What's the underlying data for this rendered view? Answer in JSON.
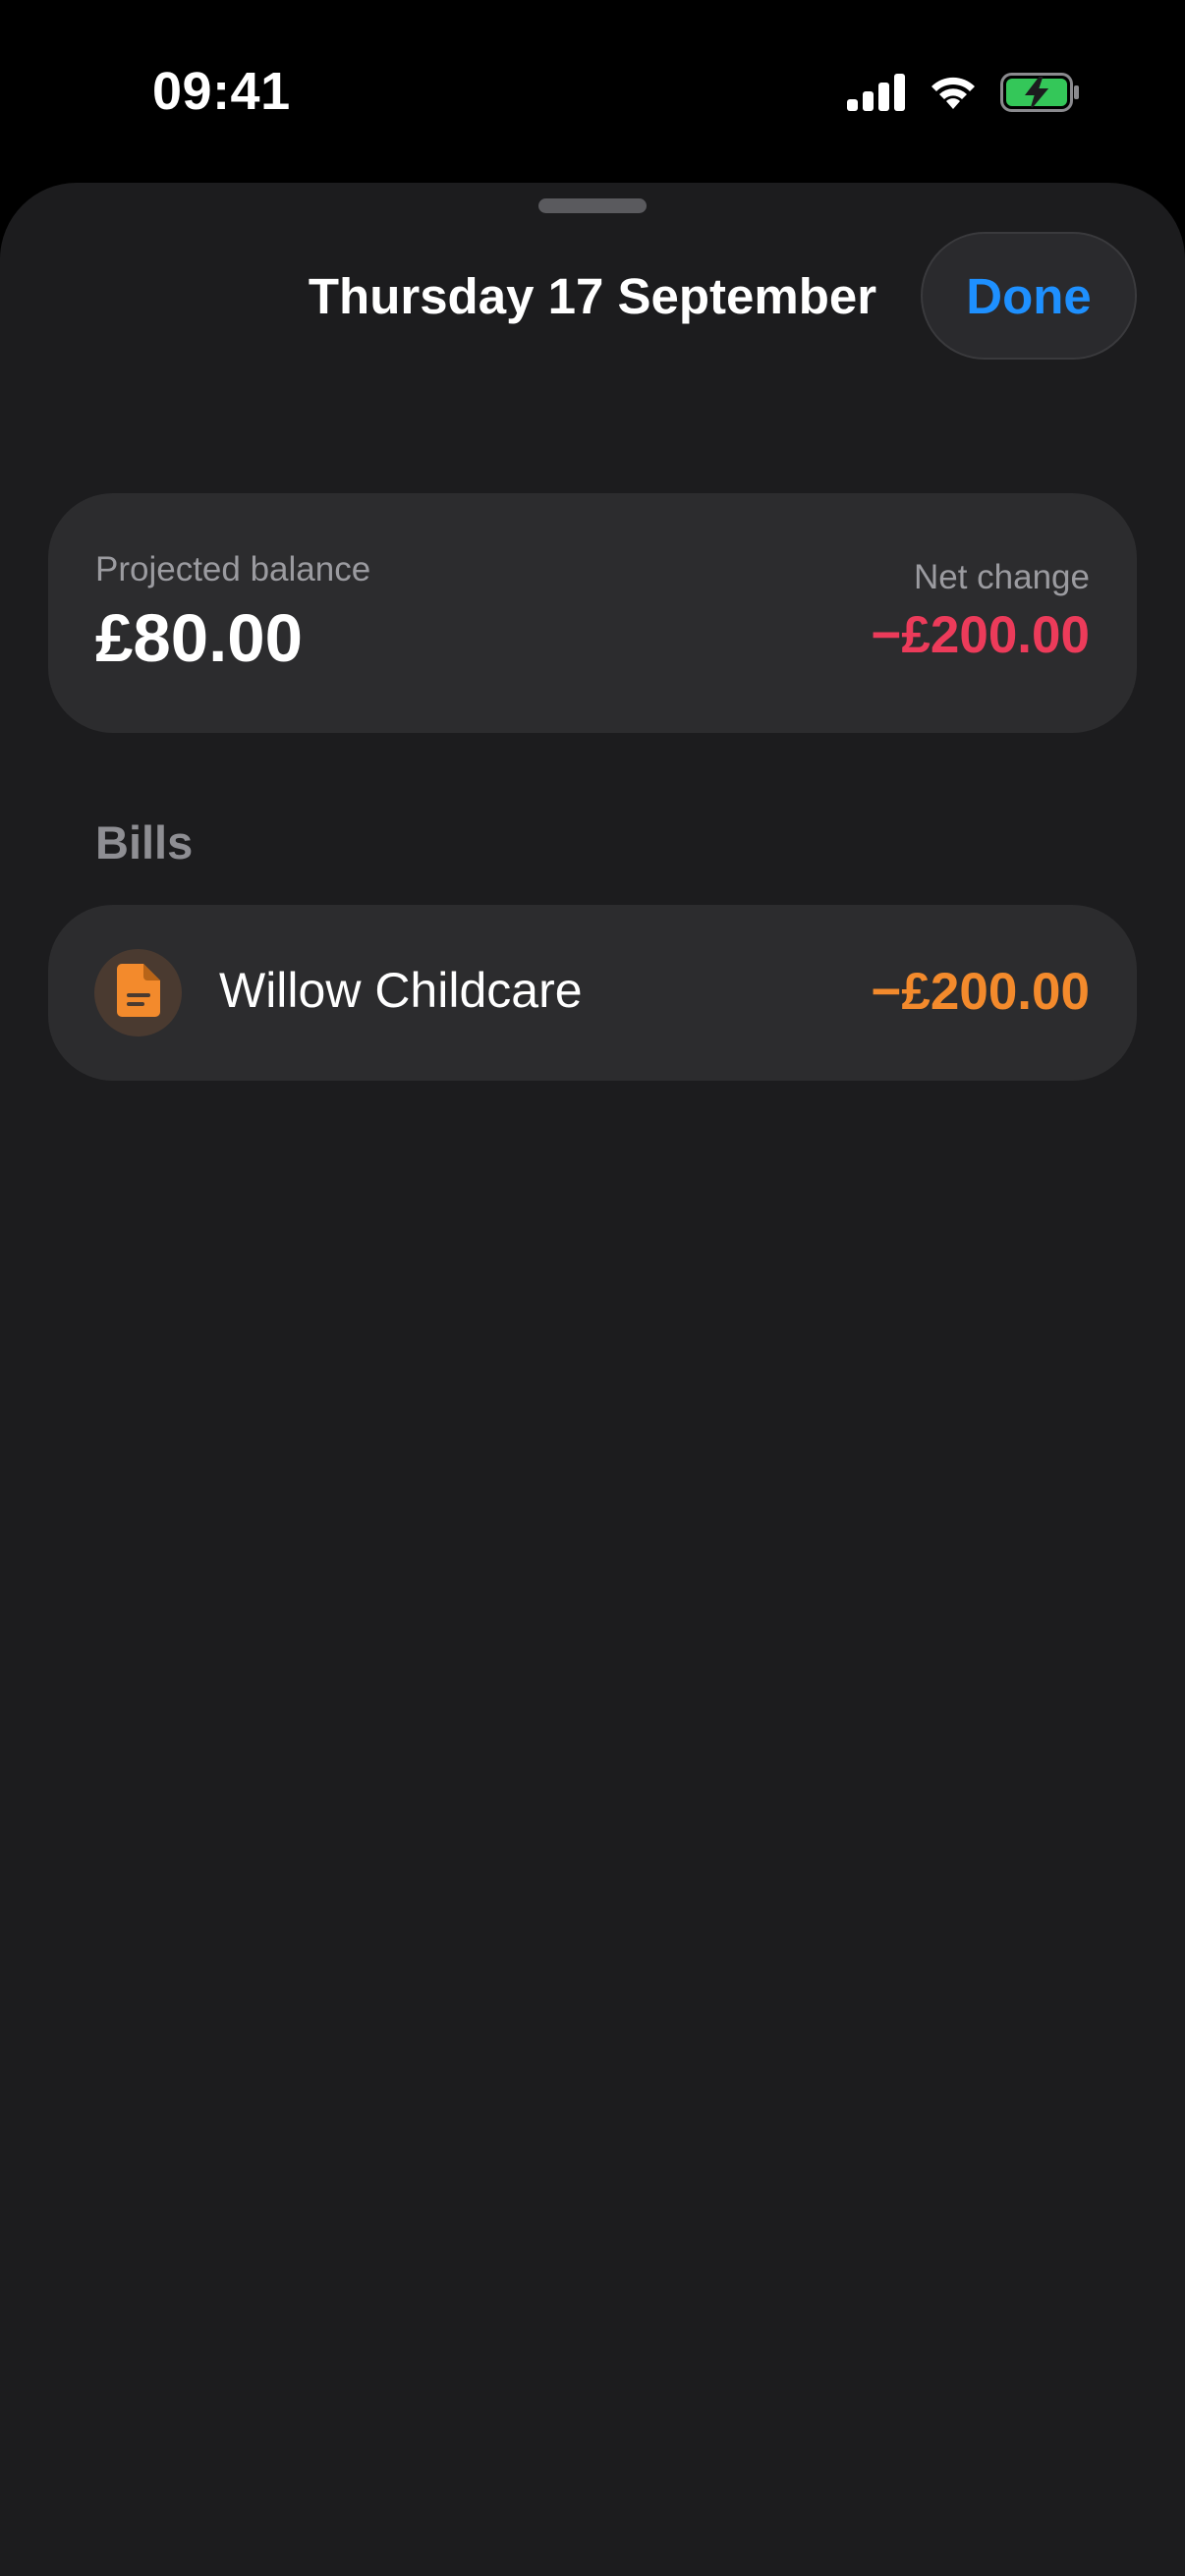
{
  "status_bar": {
    "time": "09:41",
    "icons": [
      "signal-icon",
      "wifi-icon",
      "battery-charging-icon"
    ],
    "battery_color": "#34c759"
  },
  "sheet": {
    "title": "Thursday 17 September",
    "done_label": "Done",
    "accent_color": "#1e90ff"
  },
  "summary": {
    "projected_label": "Projected balance",
    "projected_value": "£80.00",
    "net_label": "Net change",
    "net_value": "−£200.00",
    "net_color": "#ec3b5a"
  },
  "bills": {
    "header": "Bills",
    "items": [
      {
        "icon": "document-icon",
        "name": "Willow Childcare",
        "amount": "−£200.00",
        "amount_color": "#f38a2c"
      }
    ]
  }
}
